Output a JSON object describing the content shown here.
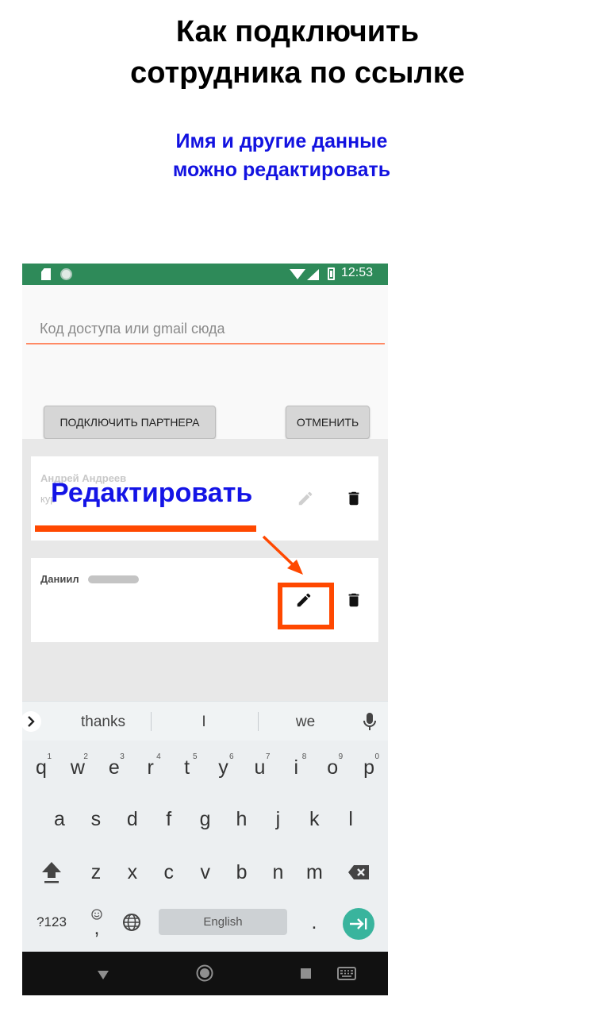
{
  "header": {
    "title_line1": "Как подключить",
    "title_line2": "сотрудника по ссылке",
    "subtitle_line1": "Имя и другие данные",
    "subtitle_line2": "можно редактировать"
  },
  "status_bar": {
    "time": "12:53",
    "bg_color": "#2e8a59"
  },
  "form": {
    "code_placeholder": "Код доступа или gmail сюда",
    "connect_label": "ПОДКЛЮЧИТЬ ПАРТНЕРА",
    "cancel_label": "ОТМЕНИТЬ"
  },
  "partners": [
    {
      "name": "Андрей Андреев",
      "sub": "кур"
    },
    {
      "name": "Даниил"
    }
  ],
  "annotation": {
    "label": "Редактировать",
    "color": "#ff4800",
    "label_color": "#1414e6"
  },
  "keyboard": {
    "suggestions": [
      "thanks",
      "I",
      "we"
    ],
    "row1": [
      "q",
      "w",
      "e",
      "r",
      "t",
      "y",
      "u",
      "i",
      "o",
      "p"
    ],
    "row1_digits": [
      "1",
      "2",
      "3",
      "4",
      "5",
      "6",
      "7",
      "8",
      "9",
      "0"
    ],
    "row2": [
      "a",
      "s",
      "d",
      "f",
      "g",
      "h",
      "j",
      "k",
      "l"
    ],
    "row3": [
      "z",
      "x",
      "c",
      "v",
      "b",
      "n",
      "m"
    ],
    "symbols_label": "?123",
    "comma": ",",
    "period": ".",
    "space_label": "English",
    "accent_color": "#39b49d"
  }
}
